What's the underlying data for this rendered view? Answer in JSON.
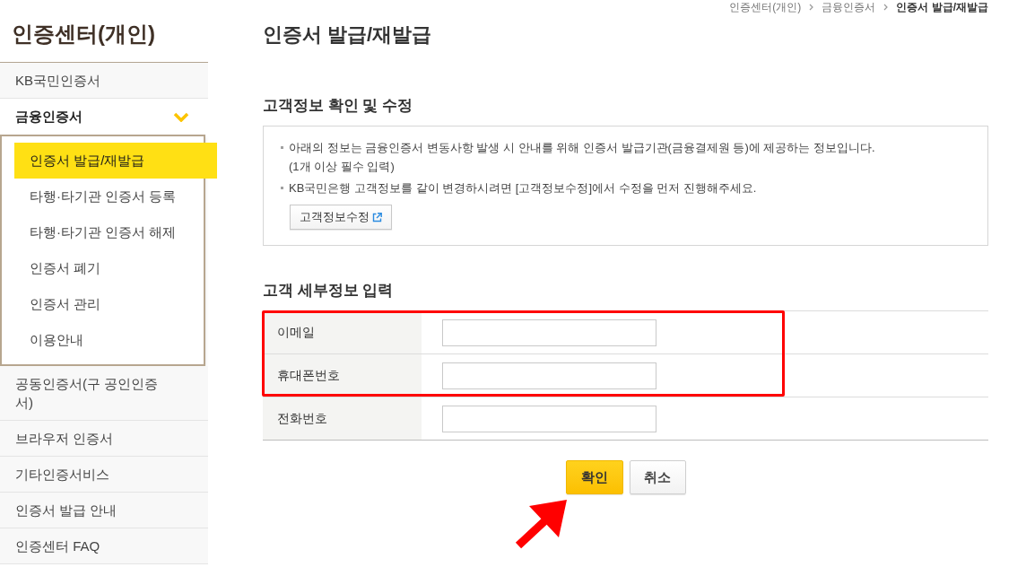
{
  "sidebar": {
    "title": "인증센터(개인)",
    "items": [
      {
        "label": "KB국민인증서",
        "expanded": false
      },
      {
        "label": "금융인증서",
        "expanded": true,
        "children": [
          {
            "label": "인증서 발급/재발급",
            "selected": true
          },
          {
            "label": "타행·타기관 인증서 등록",
            "selected": false
          },
          {
            "label": "타행·타기관 인증서 해제",
            "selected": false
          },
          {
            "label": "인증서 폐기",
            "selected": false
          },
          {
            "label": "인증서 관리",
            "selected": false
          },
          {
            "label": "이용안내",
            "selected": false
          }
        ]
      },
      {
        "label": "공동인증서(구 공인인증서)",
        "expanded": false
      },
      {
        "label": "브라우저 인증서",
        "expanded": false
      },
      {
        "label": "기타인증서비스",
        "expanded": false
      },
      {
        "label": "인증서 발급 안내",
        "expanded": false
      },
      {
        "label": "인증센터 FAQ",
        "expanded": false
      }
    ]
  },
  "breadcrumb": [
    {
      "label": "인증센터(개인)",
      "current": false
    },
    {
      "label": "금융인증서",
      "current": false
    },
    {
      "label": "인증서 발급/재발급",
      "current": true
    }
  ],
  "page_title": "인증서 발급/재발급",
  "customer_info": {
    "heading": "고객정보 확인 및 수정",
    "notes": [
      {
        "text": "아래의 정보는 금융인증서 변동사항 발생 시 안내를 위해 인증서 발급기관(금융결제원 등)에 제공하는 정보입니다.",
        "subtext": "(1개 이상 필수 입력)"
      },
      {
        "text": "KB국민은행 고객정보를 같이 변경하시려면 [고객정보수정]에서 수정을 먼저 진행해주세요."
      }
    ],
    "edit_button": "고객정보수정"
  },
  "details": {
    "heading": "고객 세부정보 입력",
    "fields": [
      {
        "label": "이메일",
        "highlighted": true
      },
      {
        "label": "휴대폰번호",
        "highlighted": true
      },
      {
        "label": "전화번호",
        "highlighted": false
      }
    ]
  },
  "buttons": [
    {
      "label": "확인",
      "kind": "primary"
    },
    {
      "label": "취소",
      "kind": "secondary"
    }
  ]
}
